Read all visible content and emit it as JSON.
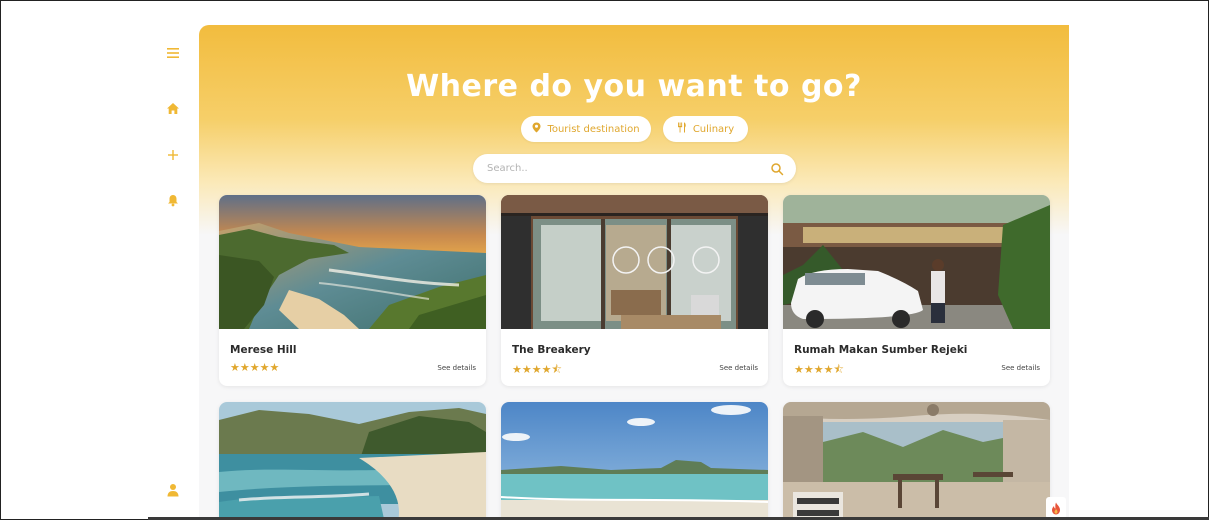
{
  "hero": {
    "title": "Where do you want to go?",
    "chips": [
      {
        "label": "Tourist destination",
        "icon": "map-pin-icon"
      },
      {
        "label": "Culinary",
        "icon": "utensils-icon"
      }
    ]
  },
  "search": {
    "placeholder": "Search..",
    "value": ""
  },
  "sidebar": {
    "icons": [
      "menu-icon",
      "home-icon",
      "plus-icon",
      "bell-icon",
      "user-icon"
    ]
  },
  "cards": [
    {
      "name": "Merese Hill",
      "rating": "★★★★★",
      "rating_value": 5,
      "link": "See details"
    },
    {
      "name": "The Breakery",
      "rating": "★★★★⯪",
      "rating_value": 4.5,
      "link": "See details"
    },
    {
      "name": "Rumah Makan Sumber Rejeki",
      "rating": "★★★★⯪",
      "rating_value": 4.5,
      "link": "See details"
    }
  ],
  "colors": {
    "accent": "#f2bc3e",
    "accent_dark": "#e0a72e",
    "background": "#f7f7f8"
  }
}
